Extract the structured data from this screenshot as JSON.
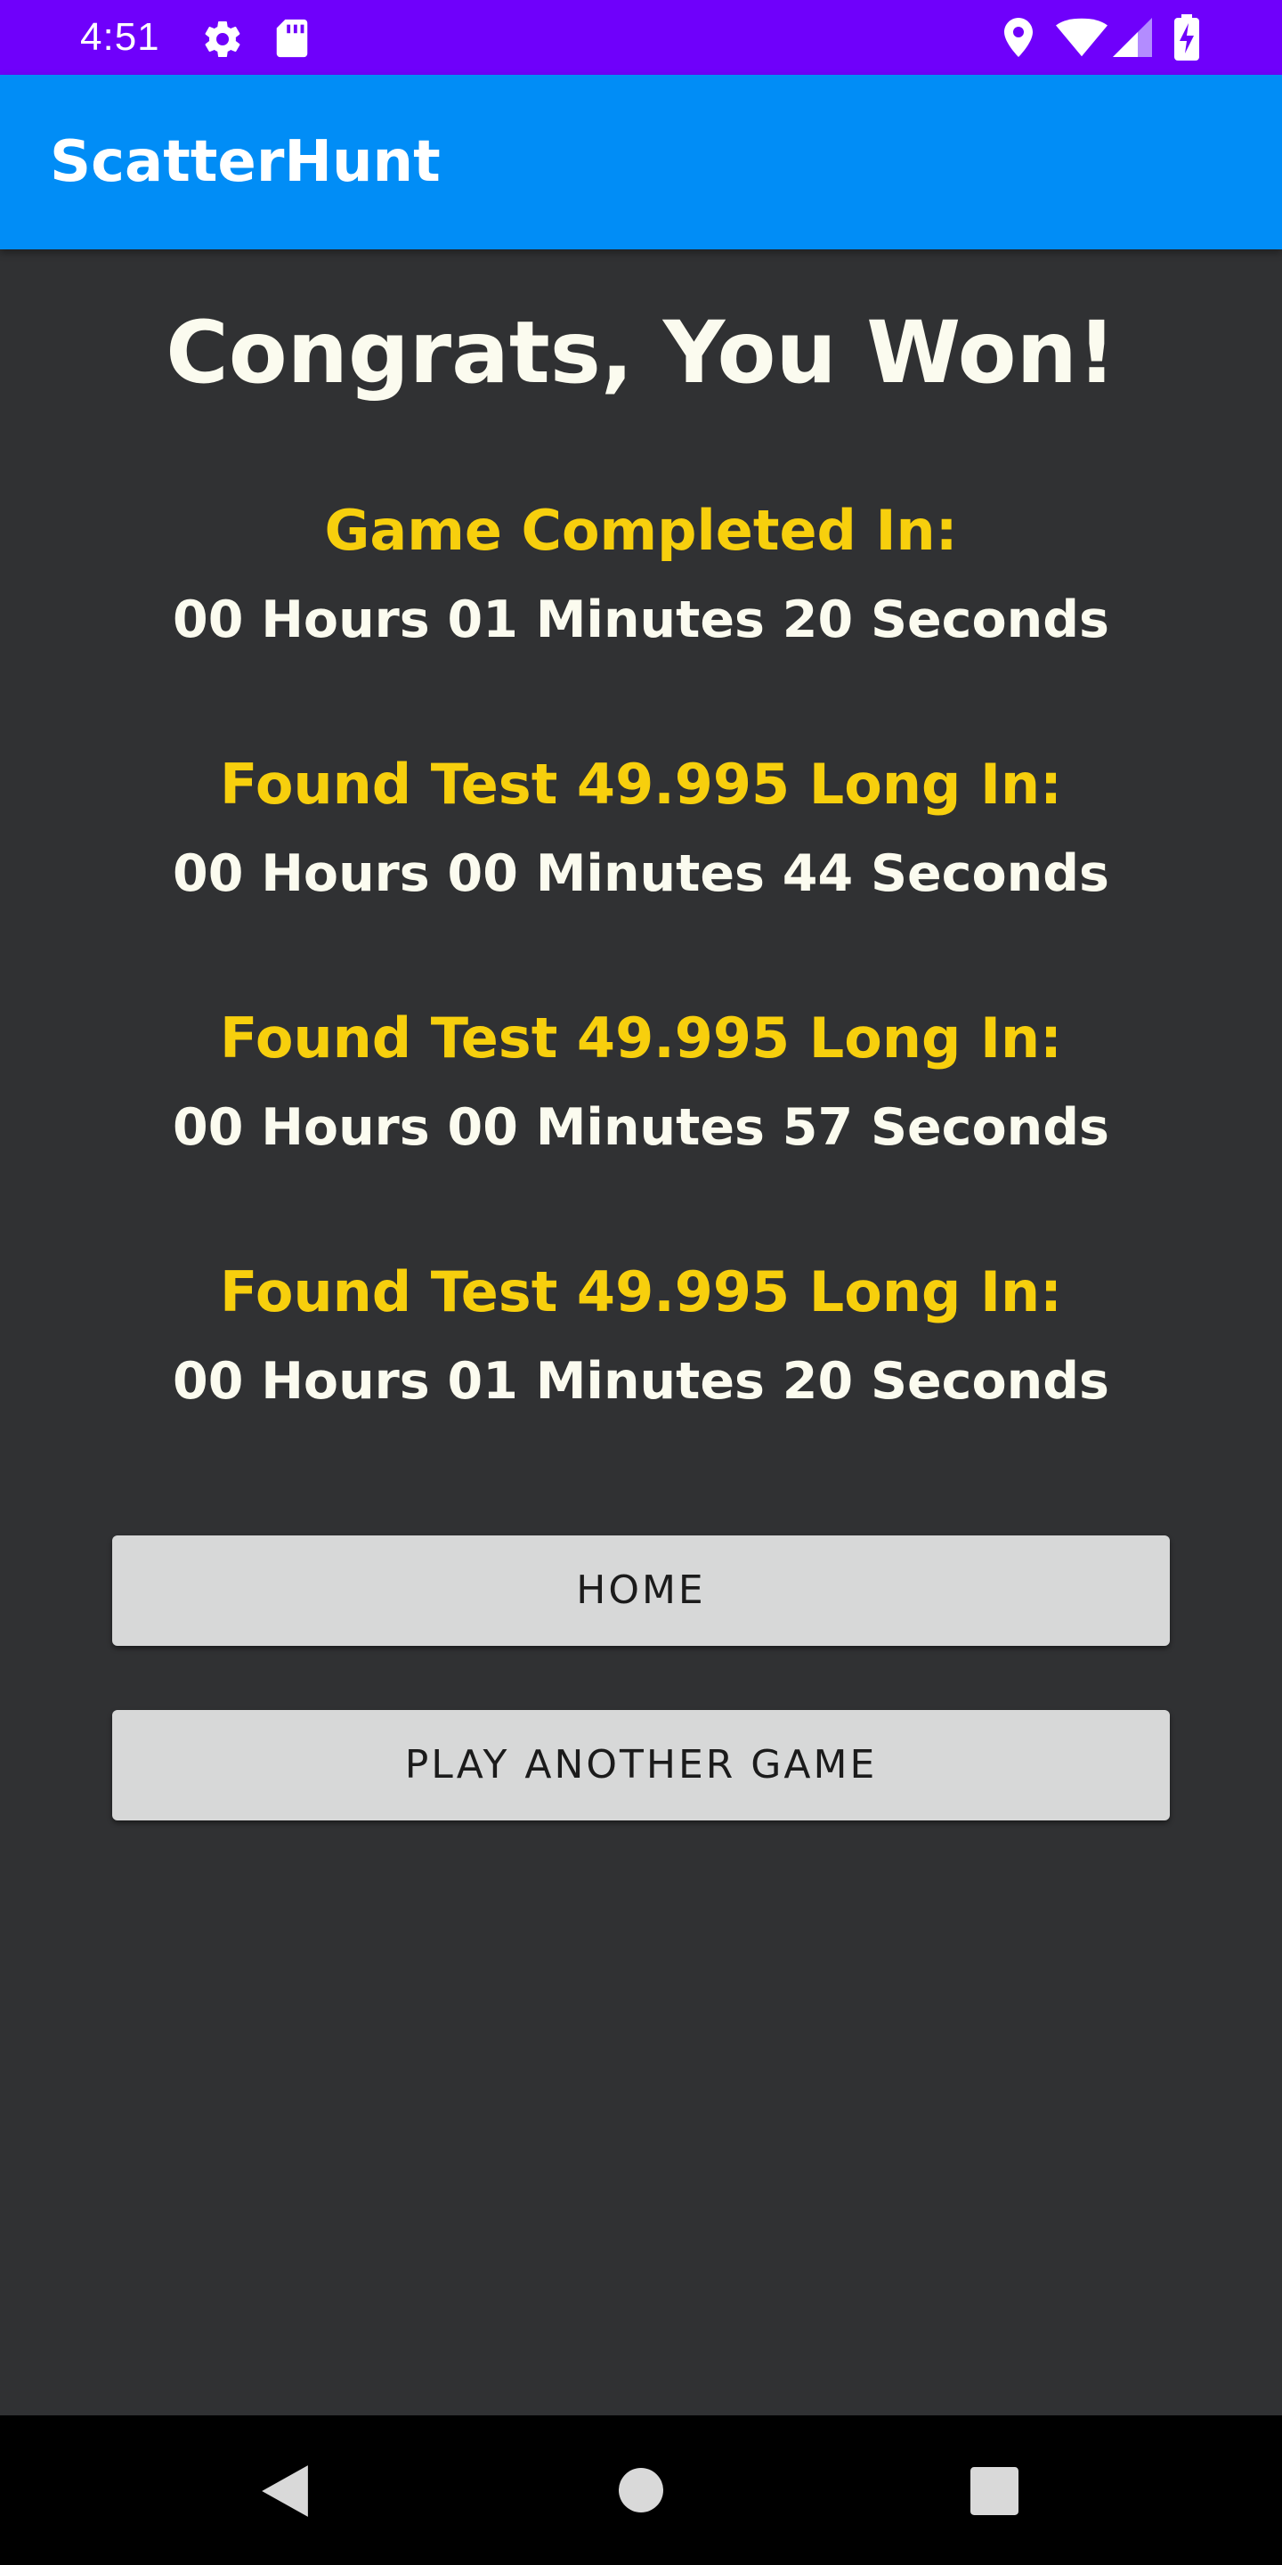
{
  "status_bar": {
    "time": "4:51",
    "icons": [
      "settings-icon",
      "sd-card-icon",
      "location-icon",
      "wifi-icon",
      "cell-signal-icon",
      "battery-charging-icon"
    ]
  },
  "app_bar": {
    "title": "ScatterHunt"
  },
  "main": {
    "headline": "Congrats, You Won!",
    "results": [
      {
        "label": "Game Completed In:",
        "value": "00 Hours 01 Minutes 20 Seconds"
      },
      {
        "label": "Found Test 49.995 Long In:",
        "value": "00 Hours 00 Minutes 44 Seconds"
      },
      {
        "label": "Found Test 49.995 Long In:",
        "value": "00 Hours 00 Minutes 57 Seconds"
      },
      {
        "label": "Found Test 49.995 Long In:",
        "value": "00 Hours 01 Minutes 20 Seconds"
      }
    ],
    "buttons": {
      "home": "HOME",
      "play_another": "PLAY ANOTHER GAME"
    }
  },
  "nav_bar": {
    "icons": [
      "back-icon",
      "home-icon",
      "recents-icon"
    ]
  },
  "colors": {
    "status_bar": "#6f00fb",
    "app_bar": "#018df6",
    "background": "#303133",
    "label": "#f7cf0d",
    "text": "#fbfbef",
    "button": "#d7d8d8"
  }
}
